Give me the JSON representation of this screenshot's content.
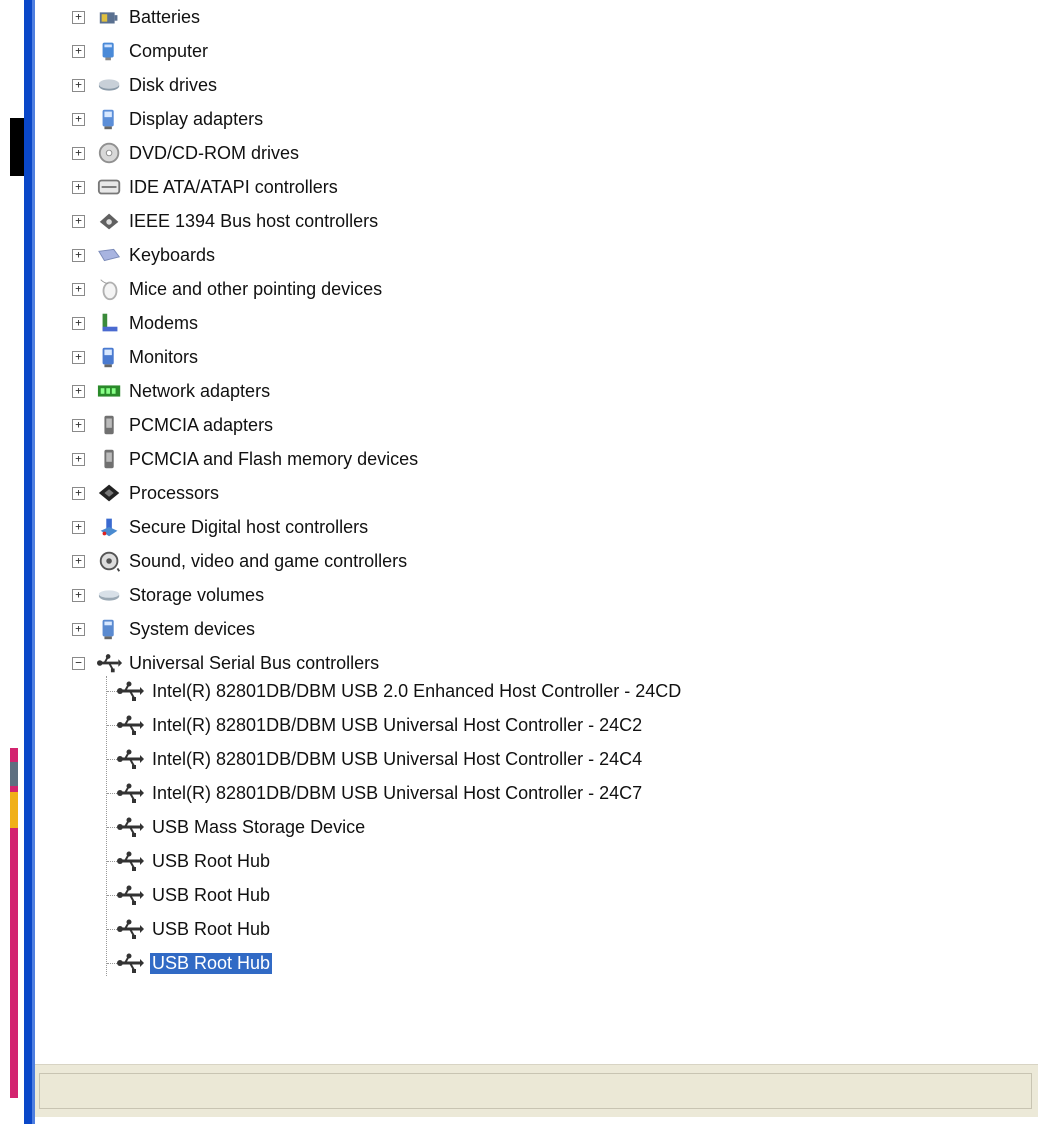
{
  "tree": {
    "categories": [
      {
        "label": "Batteries",
        "icon": "battery-icon",
        "color": "#5a7090"
      },
      {
        "label": "Computer",
        "icon": "computer-icon",
        "color": "#4a8ad8"
      },
      {
        "label": "Disk drives",
        "icon": "disk-drive-icon",
        "color": "#8a9aa8"
      },
      {
        "label": "Display adapters",
        "icon": "display-adapter-icon",
        "color": "#5b8ed8"
      },
      {
        "label": "DVD/CD-ROM drives",
        "icon": "dvd-drive-icon",
        "color": "#909090"
      },
      {
        "label": "IDE ATA/ATAPI controllers",
        "icon": "ide-controller-icon",
        "color": "#777777"
      },
      {
        "label": "IEEE 1394 Bus host controllers",
        "icon": "ieee1394-icon",
        "color": "#606060"
      },
      {
        "label": "Keyboards",
        "icon": "keyboard-icon",
        "color": "#7a8ab8"
      },
      {
        "label": "Mice and other pointing devices",
        "icon": "mouse-icon",
        "color": "#b0b0b0"
      },
      {
        "label": "Modems",
        "icon": "modem-icon",
        "color": "#3a8a3a"
      },
      {
        "label": "Monitors",
        "icon": "monitor-icon",
        "color": "#4a7ad0"
      },
      {
        "label": "Network adapters",
        "icon": "network-adapter-icon",
        "color": "#2a8a2a"
      },
      {
        "label": "PCMCIA adapters",
        "icon": "pcmcia-icon",
        "color": "#707070"
      },
      {
        "label": "PCMCIA and Flash memory devices",
        "icon": "flash-memory-icon",
        "color": "#707070"
      },
      {
        "label": "Processors",
        "icon": "processor-icon",
        "color": "#222222"
      },
      {
        "label": "Secure Digital host controllers",
        "icon": "sd-controller-icon",
        "color": "#3a6ad0"
      },
      {
        "label": "Sound, video and game controllers",
        "icon": "sound-icon",
        "color": "#555555"
      },
      {
        "label": "Storage volumes",
        "icon": "storage-volume-icon",
        "color": "#9aa8b4"
      },
      {
        "label": "System devices",
        "icon": "system-devices-icon",
        "color": "#5a8ad0"
      },
      {
        "label": "Universal Serial Bus controllers",
        "icon": "usb-icon",
        "color": "#333333"
      }
    ],
    "usb_children": [
      {
        "label": "Intel(R) 82801DB/DBM USB 2.0 Enhanced Host Controller - 24CD"
      },
      {
        "label": "Intel(R) 82801DB/DBM USB Universal Host Controller - 24C2"
      },
      {
        "label": "Intel(R) 82801DB/DBM USB Universal Host Controller - 24C4"
      },
      {
        "label": "Intel(R) 82801DB/DBM USB Universal Host Controller - 24C7"
      },
      {
        "label": "USB Mass Storage Device"
      },
      {
        "label": "USB Root Hub"
      },
      {
        "label": "USB Root Hub"
      },
      {
        "label": "USB Root Hub"
      },
      {
        "label": "USB Root Hub"
      }
    ],
    "selected_child": 8,
    "expanded_category": 19,
    "expander_collapsed": "+",
    "expander_expanded": "−"
  },
  "colors": {
    "selection": "#316ac5",
    "accent_blue": "#0a47c8",
    "statusbar": "#ece9d8"
  }
}
